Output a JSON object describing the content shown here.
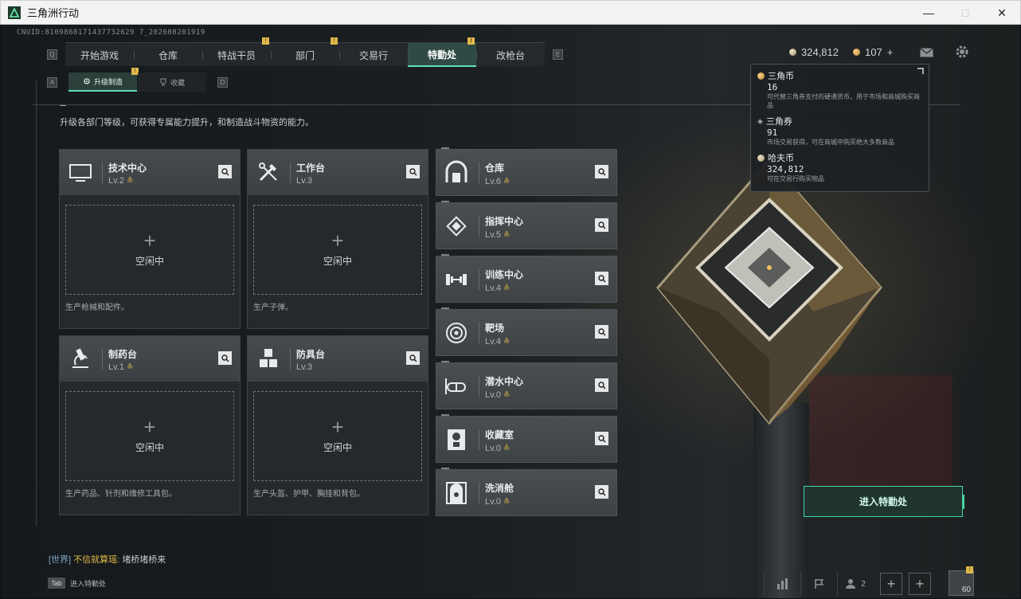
{
  "window": {
    "title": "三角洲行动",
    "controls": [
      "minimize",
      "maximize",
      "close"
    ]
  },
  "uid": "CNUID:8109868171437732629 7_202608201919",
  "nav": {
    "left_key": "Q",
    "right_key": "E",
    "tabs": [
      {
        "label": "开始游戏",
        "active": false,
        "badge": ""
      },
      {
        "label": "仓库",
        "active": false,
        "badge": ""
      },
      {
        "label": "特战干员",
        "active": false,
        "badge": "!"
      },
      {
        "label": "部门",
        "active": false,
        "badge": "!"
      },
      {
        "label": "交易行",
        "active": false,
        "badge": ""
      },
      {
        "label": "特勤处",
        "active": true,
        "badge": "!"
      },
      {
        "label": "改枪台",
        "active": false,
        "badge": ""
      }
    ]
  },
  "sub_nav": {
    "left_key": "A",
    "right_key": "D",
    "tabs": [
      {
        "label": "升级制造",
        "active": true,
        "badge": "!"
      },
      {
        "label": "收藏",
        "active": false,
        "badge": ""
      }
    ]
  },
  "currency": {
    "hafu_coin": "324,812",
    "triangle_coin": "107",
    "add_label": "+"
  },
  "intro": "升级各部门等级，可获得专属能力提升，和制造战斗物资的能力。",
  "workbenches": [
    {
      "name": "技术中心",
      "level": "Lv.2",
      "upgradable": true,
      "icon": "monitor-icon",
      "slot_status": "空闲中",
      "slot_plus": "+",
      "desc": "生产枪械和配件。"
    },
    {
      "name": "工作台",
      "level": "Lv.3",
      "upgradable": false,
      "icon": "tools-icon",
      "slot_status": "空闲中",
      "slot_plus": "+",
      "desc": "生产子弹。"
    },
    {
      "name": "制药台",
      "level": "Lv.1",
      "upgradable": true,
      "icon": "microscope-icon",
      "slot_status": "空闲中",
      "slot_plus": "+",
      "desc": "生产药品、针剂和维修工具包。"
    },
    {
      "name": "防具台",
      "level": "Lv.3",
      "upgradable": false,
      "icon": "cubes-icon",
      "slot_status": "空闲中",
      "slot_plus": "+",
      "desc": "生产头盔、护甲、胸挂和背包。"
    }
  ],
  "facilities": [
    {
      "name": "仓库",
      "level": "Lv.6",
      "icon": "warehouse-icon"
    },
    {
      "name": "指挥中心",
      "level": "Lv.5",
      "icon": "chip-icon"
    },
    {
      "name": "训练中心",
      "level": "Lv.4",
      "icon": "dumbbell-icon"
    },
    {
      "name": "靶场",
      "level": "Lv.4",
      "icon": "target-icon"
    },
    {
      "name": "潜水中心",
      "level": "Lv.0",
      "icon": "goggles-icon"
    },
    {
      "name": "收藏室",
      "level": "Lv.0",
      "icon": "trophy-icon"
    },
    {
      "name": "洗消舱",
      "level": "Lv.0",
      "icon": "decon-icon"
    }
  ],
  "tooltip": {
    "items": [
      {
        "name": "三角币",
        "value": "16",
        "desc": "可代替三角券支付的硬通货币，用于市场和商城购买商品"
      },
      {
        "name": "三角券",
        "value": "91",
        "desc": "市场交易获得，可在商城中购买绝大多数商品"
      },
      {
        "name": "哈夫币",
        "value": "324,812",
        "desc": "可在交易行购买物品"
      }
    ]
  },
  "enter_button": "进入特勤处",
  "chat": {
    "channel": "[世界]",
    "sender": "不信就算瑶:",
    "message": "堵桥堵桥来"
  },
  "tab_hint": {
    "key": "Tab",
    "label": "进入特勤处"
  },
  "bottom": {
    "friend_count": "2",
    "player_level": "60",
    "notif": "!"
  },
  "colors": {
    "accent": "#45d3a1",
    "warning": "#e0b84a"
  }
}
